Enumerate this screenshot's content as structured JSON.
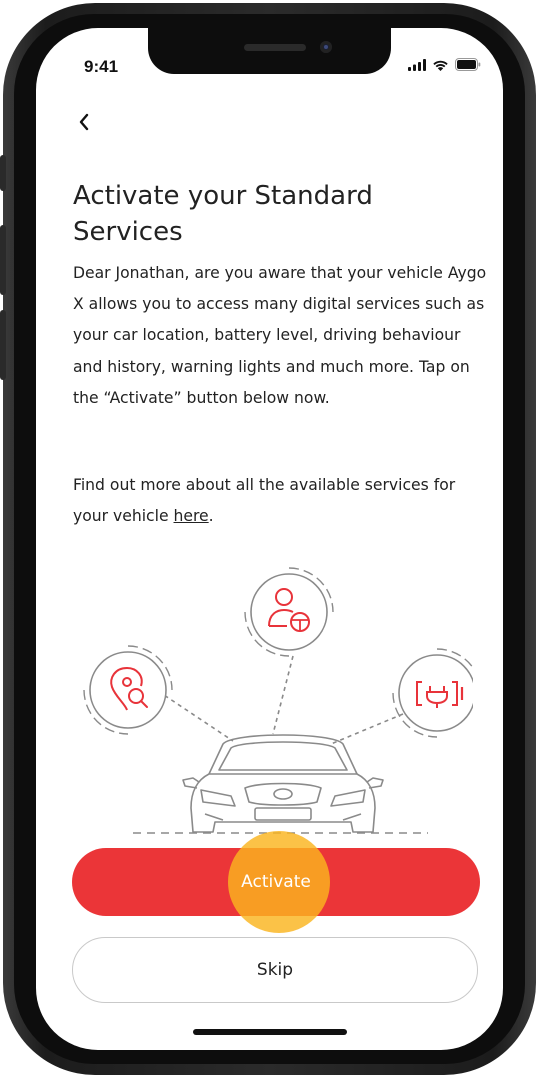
{
  "status_bar": {
    "time": "9:41",
    "icons": [
      "cellular-signal-icon",
      "wifi-icon",
      "battery-icon"
    ]
  },
  "nav": {
    "back_icon": "chevron-left-icon"
  },
  "content": {
    "title": "Activate your Standard Services",
    "body": "Dear Jonathan, are you aware that your vehicle Aygo X allows you to access many digital services such as your car location, battery level, driving behaviour and history, warning lights and much more. Tap on the “Activate” button below now.",
    "more_prefix": "Find out more about all the available services for your vehicle ",
    "more_link": "here",
    "more_suffix": "."
  },
  "illustration": {
    "icons": [
      "location-search-icon",
      "driver-profile-icon",
      "ev-battery-icon",
      "car-front-icon"
    ],
    "accent_color": "#e8333a",
    "line_color": "#8a8a8a"
  },
  "actions": {
    "activate_label": "Activate",
    "skip_label": "Skip"
  },
  "colors": {
    "primary": "#eb3538",
    "tap_indicator": "#fab41e",
    "text": "#222222"
  }
}
